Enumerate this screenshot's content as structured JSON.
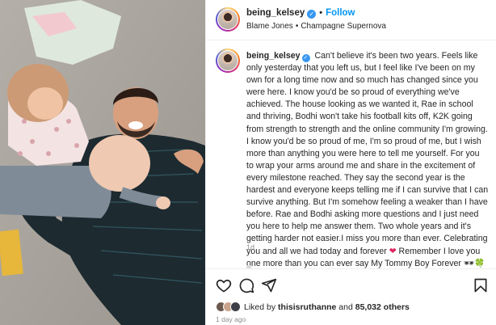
{
  "post": {
    "username": "being_kelsey",
    "follow_label": "Follow",
    "dot": "•",
    "audio": {
      "artist": "Blame Jones",
      "separator": "•",
      "track": "Champagne Supernova"
    }
  },
  "caption": {
    "username": "being_kelsey",
    "text": "Can't believe it's been two years. Feels like only yesterday that you left us, but I feel like I've been on my own for a long time now and so much has changed since you were here. I know you'd be so proud of everything we've achieved. The house looking as we wanted it, Rae in school and thriving, Bodhi won't take his football kits off, K2K going from strength to strength and the online community I'm growing. I know you'd be so proud of me, I'm so proud of me, but I wish more than anything you were here to tell me yourself. For you to wrap your arms around me and share in the excitement of every milestone reached. They say the second year is the hardest and everyone keeps telling me if I can survive that I can survive anything. But I'm somehow feeling a weaker than I have before. Rae and Bodhi asking more questions and I just need you here to help me answer them. Two whole years and it's getting harder not easier.I miss you more than ever. Celebrating you and all we had today and forever",
    "heart": "❤",
    "text2": "Remember I love you one more than you can ever say My Tommy Boy Forever",
    "emojis": "🕶🍀xxx",
    "time": "1d"
  },
  "actions": {
    "liked_by_prefix": "Liked by",
    "liked_by_user": "thisisruthanne",
    "liked_by_and": "and",
    "likes_count": "85,032 others",
    "time_ago": "1 day ago"
  },
  "icons": {
    "like": "heart-icon",
    "comment": "comment-icon",
    "share": "share-icon",
    "save": "bookmark-icon",
    "verified": "verified-badge-icon"
  },
  "colors": {
    "link": "#0095f6",
    "verified": "#3897f0",
    "muted": "#8e8e8e",
    "heart": "#e0245e"
  }
}
